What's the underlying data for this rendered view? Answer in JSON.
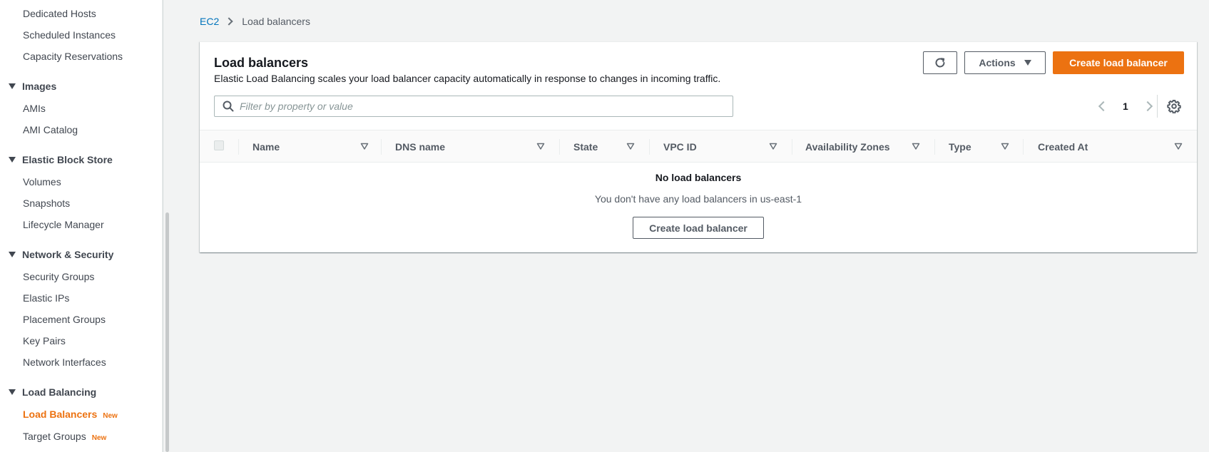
{
  "sidebar": {
    "links_top": [
      {
        "label": "Dedicated Hosts"
      },
      {
        "label": "Scheduled Instances"
      },
      {
        "label": "Capacity Reservations"
      }
    ],
    "sections": [
      {
        "label": "Images",
        "items": [
          {
            "label": "AMIs"
          },
          {
            "label": "AMI Catalog"
          }
        ]
      },
      {
        "label": "Elastic Block Store",
        "items": [
          {
            "label": "Volumes"
          },
          {
            "label": "Snapshots"
          },
          {
            "label": "Lifecycle Manager"
          }
        ]
      },
      {
        "label": "Network & Security",
        "items": [
          {
            "label": "Security Groups"
          },
          {
            "label": "Elastic IPs"
          },
          {
            "label": "Placement Groups"
          },
          {
            "label": "Key Pairs"
          },
          {
            "label": "Network Interfaces"
          }
        ]
      },
      {
        "label": "Load Balancing",
        "items": [
          {
            "label": "Load Balancers",
            "badge": "New",
            "active": true
          },
          {
            "label": "Target Groups",
            "badge": "New"
          }
        ]
      }
    ]
  },
  "breadcrumb": {
    "root": "EC2",
    "current": "Load balancers"
  },
  "panel": {
    "title": "Load balancers",
    "description": "Elastic Load Balancing scales your load balancer capacity automatically in response to changes in incoming traffic.",
    "actions_label": "Actions",
    "create_label": "Create load balancer",
    "filter_placeholder": "Filter by property or value",
    "page_number": "1"
  },
  "table": {
    "columns": [
      "Name",
      "DNS name",
      "State",
      "VPC ID",
      "Availability Zones",
      "Type",
      "Created At"
    ],
    "empty_title": "No load balancers",
    "empty_description": "You don't have any load balancers in us-east-1",
    "empty_button": "Create load balancer"
  },
  "colors": {
    "accent": "#ec7211",
    "link": "#0073bb"
  },
  "icons": {
    "refresh": "refresh-icon",
    "settings": "gear-icon",
    "search": "search-icon",
    "sort": "sort-caret-icon"
  }
}
